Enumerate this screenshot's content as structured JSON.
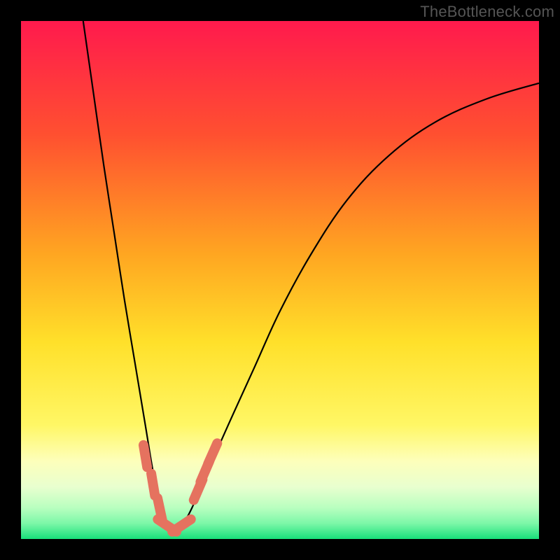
{
  "watermark": "TheBottleneck.com",
  "chart_data": {
    "type": "line",
    "title": "",
    "xlabel": "",
    "ylabel": "",
    "xlim": [
      0,
      100
    ],
    "ylim": [
      0,
      100
    ],
    "grid": false,
    "legend": false,
    "annotations": [],
    "gradient_stops": [
      {
        "y": 100,
        "color": "#ff1a4d"
      },
      {
        "y": 78,
        "color": "#ff5030"
      },
      {
        "y": 55,
        "color": "#ffa621"
      },
      {
        "y": 38,
        "color": "#ffe02a"
      },
      {
        "y": 22,
        "color": "#fff765"
      },
      {
        "y": 15,
        "color": "#fdffbb"
      },
      {
        "y": 10,
        "color": "#e8ffcf"
      },
      {
        "y": 6,
        "color": "#b8ffbf"
      },
      {
        "y": 3,
        "color": "#7cf7a8"
      },
      {
        "y": 0,
        "color": "#18e07a"
      }
    ],
    "series": [
      {
        "name": "bottleneck-curve",
        "color": "#000000",
        "x": [
          12,
          14,
          16,
          18,
          20,
          22,
          24,
          25.5,
          27,
          28,
          29.5,
          31,
          33,
          36,
          40,
          45,
          50,
          56,
          63,
          71,
          80,
          90,
          100
        ],
        "y": [
          100,
          86,
          72,
          59,
          46,
          34,
          22,
          13,
          6,
          2.5,
          1.5,
          2.5,
          6,
          13,
          22,
          33,
          44,
          55,
          65.5,
          74,
          80.5,
          85,
          88
        ]
      }
    ],
    "markers": [
      {
        "name": "left-cluster-top",
        "x": 24.0,
        "y": 16.0,
        "color": "#e5725f"
      },
      {
        "name": "left-cluster-mid",
        "x": 25.5,
        "y": 10.5,
        "color": "#e5725f"
      },
      {
        "name": "left-cluster-low",
        "x": 26.8,
        "y": 5.8,
        "color": "#e5725f"
      },
      {
        "name": "trough-left",
        "x": 28.2,
        "y": 2.6,
        "color": "#e5725f"
      },
      {
        "name": "trough-right",
        "x": 31.0,
        "y": 2.6,
        "color": "#e5725f"
      },
      {
        "name": "right-cluster-low",
        "x": 34.2,
        "y": 9.5,
        "color": "#e5725f"
      },
      {
        "name": "right-cluster-mid",
        "x": 35.5,
        "y": 13.0,
        "color": "#e5725f"
      },
      {
        "name": "right-cluster-top",
        "x": 37.0,
        "y": 16.5,
        "color": "#e5725f"
      }
    ]
  }
}
